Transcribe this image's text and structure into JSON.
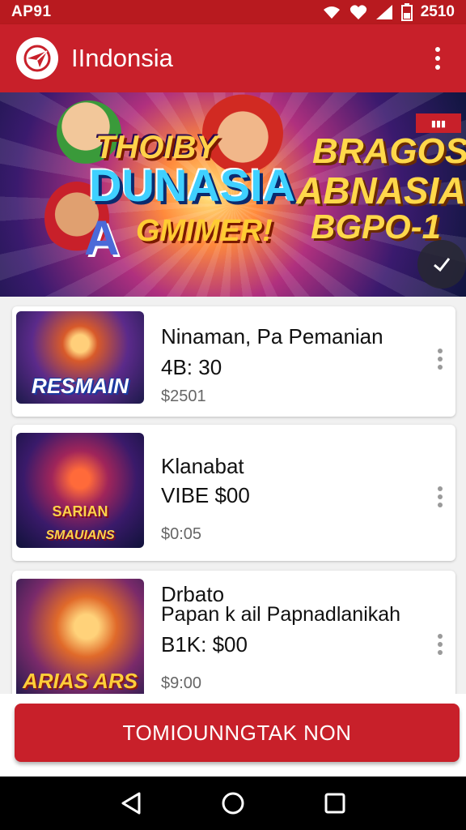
{
  "status_bar": {
    "time": "AP91",
    "clock": "2510"
  },
  "app_bar": {
    "title": "IIndonsia",
    "logo_icon": "paper-plane-icon",
    "menu_icon": "more-vert-icon"
  },
  "banner": {
    "left_line1": "THOIBY",
    "left_line2": "DUNASIA",
    "left_line3": "GMIMER!",
    "badge_letter": "A",
    "right_line1": "BRAGOS",
    "right_line2": "ABNASIA",
    "right_line3": "BGPO-1"
  },
  "games": [
    {
      "thumb_caption": "RESMAIN",
      "name": "Ninaman, Pa Pemanian",
      "subtitle": "",
      "price": "4B: 30",
      "meta": "$2501"
    },
    {
      "thumb_caption_top": "SARIAN",
      "thumb_caption": "SMAUIANS",
      "name": "Klanabat",
      "subtitle": "",
      "price": "VIBE $00",
      "meta": "$0:05"
    },
    {
      "thumb_caption": "ARIAS ARS",
      "name": "Drbato",
      "subtitle": "Papan k ail Papnadlanikah",
      "price": "B1K: $00",
      "meta": "$9:00"
    }
  ],
  "cta": {
    "label": "TOMIOUNNGTAK NON"
  },
  "colors": {
    "primary": "#c8202a",
    "status": "#b81a1f"
  }
}
